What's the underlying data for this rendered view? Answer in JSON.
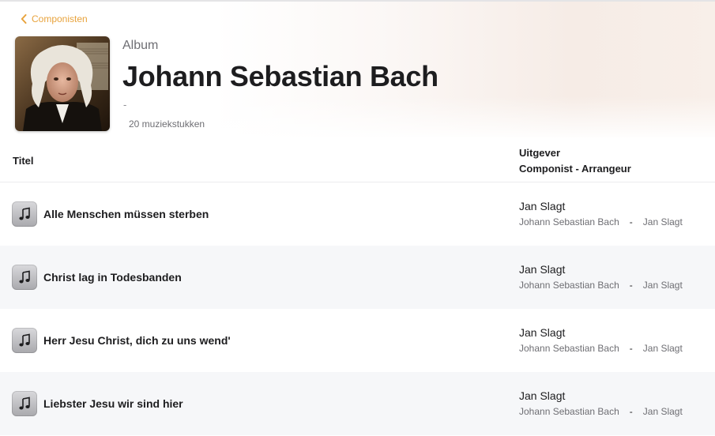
{
  "nav": {
    "back_label": "Componisten"
  },
  "album": {
    "kind": "Album",
    "title": "Johann Sebastian Bach",
    "subtitle": "-",
    "count": "20 muziekstukken"
  },
  "columns": {
    "title": "Titel",
    "publisher": "Uitgever",
    "composer_arranger": "Componist - Arrangeur"
  },
  "tracks": [
    {
      "title": "Alle Menschen müssen sterben",
      "publisher": "Jan Slagt",
      "composer": "Johann Sebastian Bach",
      "separator": "-",
      "arranger": "Jan Slagt"
    },
    {
      "title": "Christ lag in Todesbanden",
      "publisher": "Jan Slagt",
      "composer": "Johann Sebastian Bach",
      "separator": "-",
      "arranger": "Jan Slagt"
    },
    {
      "title": "Herr Jesu Christ, dich zu uns wend'",
      "publisher": "Jan Slagt",
      "composer": "Johann Sebastian Bach",
      "separator": "-",
      "arranger": "Jan Slagt"
    },
    {
      "title": "Liebster Jesu wir sind hier",
      "publisher": "Jan Slagt",
      "composer": "Johann Sebastian Bach",
      "separator": "-",
      "arranger": "Jan Slagt"
    }
  ],
  "colors": {
    "accent": "#e8a33d",
    "row_alt": "#f6f7f9"
  },
  "icons": {
    "back": "chevron-left-icon",
    "track": "music-note-icon",
    "cover": "portrait-cover-art"
  }
}
